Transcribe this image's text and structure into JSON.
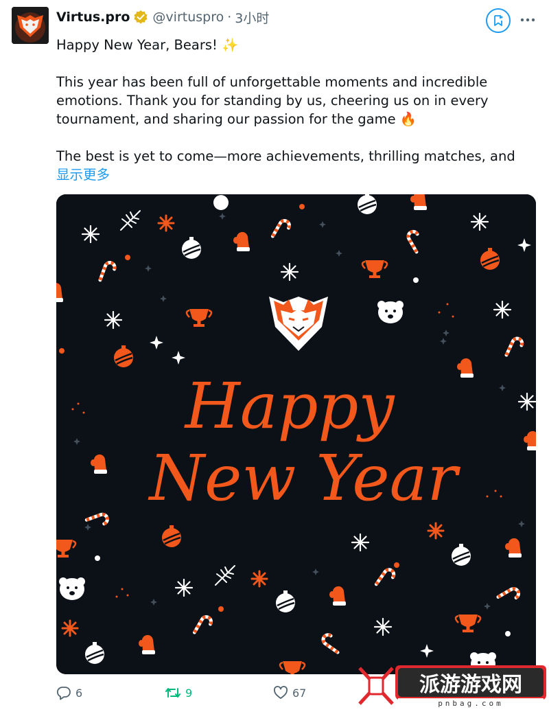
{
  "author": {
    "name": "Virtus.pro",
    "handle": "@virtuspro",
    "separator": "·",
    "time": "3小时"
  },
  "tweet": {
    "paragraphs": [
      "Happy New Year, Bears! ✨",
      "This year has been full of unforgettable moments and incredible emotions. Thank you for standing by us, cheering us on in every tournament, and sharing our passion for the game 🔥",
      "The best is yet to come—more achievements, thrilling matches, and"
    ],
    "show_more": "显示更多"
  },
  "media": {
    "greeting_line1": "Happy",
    "greeting_line2": "New Year",
    "colors": {
      "background": "#0c1117",
      "accent": "#f2571c",
      "white": "#ffffff"
    }
  },
  "actions": {
    "reply_count": "6",
    "retweet_count": "9",
    "like_count": "67"
  },
  "watermark": {
    "text": "派游游戏网",
    "url": "pnbag.com"
  },
  "icons": {
    "verified": "verified-badge-icon",
    "grok": "grok-icon",
    "more": "more-icon",
    "reply": "reply-icon",
    "retweet": "retweet-icon",
    "like": "like-icon"
  }
}
